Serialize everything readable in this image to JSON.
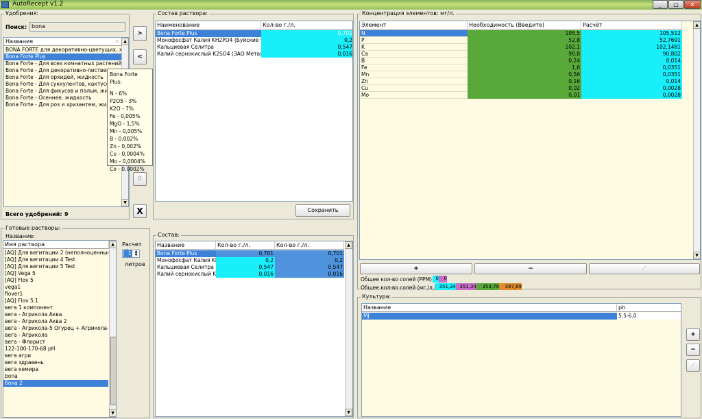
{
  "window": {
    "title": "AutoRecept v1.2",
    "min": "_",
    "max": "□",
    "close": "×"
  },
  "fertilizers": {
    "group_label": "Удобрения:",
    "search_label": "Поиск:",
    "search_value": "bona",
    "header": "Названия",
    "items": [
      "BONA FORTE для декоративно-цветущих, жид",
      "Bona Forte Plus",
      "Bona Forte - Для всех комнатных растений, ж",
      "Bona Forte - Для декоративно-лиственных, ж",
      "Bona Forte - Для орхидей, жидкость",
      "Bona Forte - Для суккулентов, кактусов, ж",
      "Bona Forte - Для фикусов и пальм, жидкость",
      "Bona Forte - Осеннее, жидкость",
      "Bona Forte - Для роз и хризантем, жидкость"
    ],
    "total_label": "Всего удобрений:",
    "total_value": "9"
  },
  "tooltip": {
    "title": "Bona Forte Plus:",
    "lines": [
      "N - 6%",
      "P2O5 - 3%",
      "K2O - 7%",
      "Fe - 0,005%",
      "MgO - 1,5%",
      "Mn - 0,005%",
      "B - 0,002%",
      "Zn - 0,002%",
      "Cu - 0,0004%",
      "Mo - 0,0004%",
      "Co - 0,0002%"
    ]
  },
  "transfer": {
    "add": ">",
    "remove": "<",
    "zero": "0",
    "clear": "X"
  },
  "composition": {
    "group_label": "Состав раствора:",
    "headers": [
      "Наименование",
      "Кол-во г./л."
    ],
    "rows": [
      {
        "name": "Bona Forte Plus",
        "qty": "0,701"
      },
      {
        "name": "Монофосфат Калия KH2PO4 (Буйские уд-",
        "qty": "0,2"
      },
      {
        "name": "Кальциевая Селитра",
        "qty": "0,547"
      },
      {
        "name": "Калий сернокислый K2SO4 (ЗАО Метахи-",
        "qty": "0,016"
      }
    ],
    "save": "Сохранить"
  },
  "concentration": {
    "group_label": "Концентрация элементов: мг/л.",
    "headers": [
      "Элемент",
      "Необходимость (Введите)",
      "Расчёт"
    ],
    "rows": [
      {
        "el": "N",
        "need": "105,5",
        "calc": "105,512"
      },
      {
        "el": "P",
        "need": "52,8",
        "calc": "52,7691"
      },
      {
        "el": "K",
        "need": "102,1",
        "calc": "102,1481"
      },
      {
        "el": "Ca",
        "need": "90,8",
        "calc": "90,802"
      },
      {
        "el": "B",
        "need": "0,24",
        "calc": "0,014"
      },
      {
        "el": "Fe",
        "need": "1,6",
        "calc": "0,0351"
      },
      {
        "el": "Mn",
        "need": "0,56",
        "calc": "0,0351"
      },
      {
        "el": "Zn",
        "need": "0,16",
        "calc": "0,014"
      },
      {
        "el": "Cu",
        "need": "0,02",
        "calc": "0,0028"
      },
      {
        "el": "Mo",
        "need": "0,01",
        "calc": "0,0028"
      }
    ],
    "plus": "+",
    "minus": "−",
    "chart": "⟋"
  },
  "salts": {
    "ppm_label": "Общее кол-во солей (PPM):",
    "ppm_values": [
      "0",
      "0"
    ],
    "mg_label": "Общее кол-во солей (мг./л.):",
    "mg_values": [
      "351,34",
      "351,34",
      "353,79",
      "397,69"
    ],
    "colors": [
      "#19eefb",
      "#c86ec8",
      "#59a93a",
      "#e08a2e"
    ]
  },
  "ready": {
    "group_label": "Готовые растворы:",
    "name_label": "Название:",
    "header": "Имя раствора",
    "items": [
      "[AQ] Для вегитации 2 (неполноценный)",
      "[AQ] Для вегитации 4 Test",
      "[AQ] Для вегитации 5 Test",
      "[AQ] Vega 5",
      "[AQ] Flov 5",
      "vega1",
      "flover1",
      "[AQ] Flov 5.1",
      "вега 1 компонент",
      "вега - Агрикола Аква",
      "вега - Агрикола Аква 2",
      "вега - Агрикола-5 Огурец + Агрикола-6 Р.",
      "вега - Агрикола",
      "вега - Флорист",
      "122-100-170-68 pH",
      "вега агри",
      "вега здравень",
      "вега кемира",
      "bona",
      "бона 2"
    ],
    "calc_label": "Расчет на:",
    "calc_value": "1",
    "liters": "литров"
  },
  "sostav": {
    "group_label": "Состав:",
    "headers": [
      "Название",
      "Кол-во г./л.",
      "Кол-во г./л."
    ],
    "rows": [
      {
        "name": "Bona Forte Plus",
        "a": "0,701",
        "b": "0,701"
      },
      {
        "name": "Монофосфат Калия KH2",
        "a": "0,2",
        "b": "0,2"
      },
      {
        "name": "Кальциевая Селитра",
        "a": "0,547",
        "b": "0,547"
      },
      {
        "name": "Калий сернокислый K2",
        "a": "0,016",
        "b": "0,016"
      }
    ]
  },
  "culture": {
    "group_label": "Культура:",
    "headers": [
      "Название",
      "ph"
    ],
    "rows": [
      {
        "name": "MJ",
        "ph": "5.5-6.0"
      }
    ],
    "plus": "+",
    "minus": "−",
    "chart": "⟋"
  }
}
